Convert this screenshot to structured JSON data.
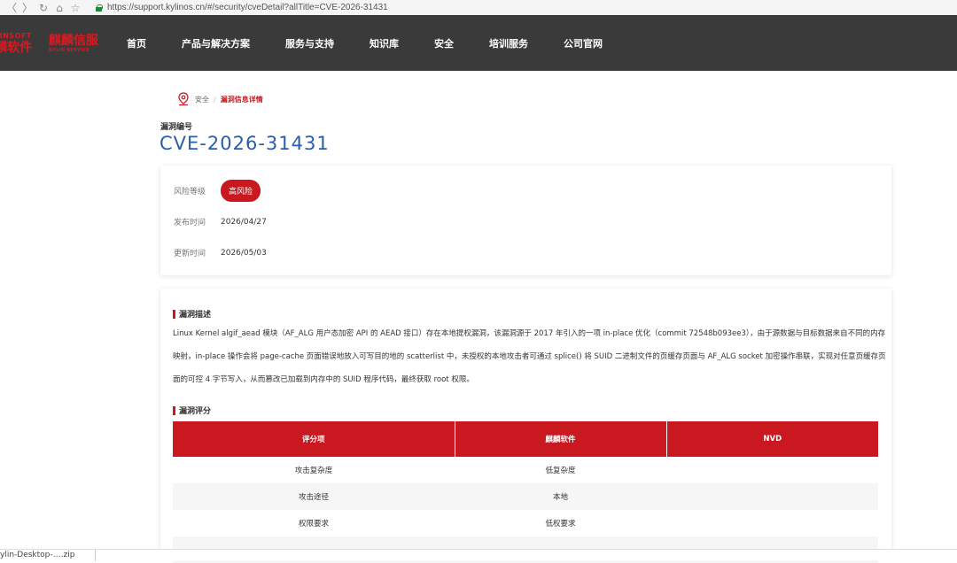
{
  "browser": {
    "back": "〈",
    "forward": "〉",
    "reload": "↻",
    "home": "⌂",
    "star": "☆",
    "url": "https://support.kylinos.cn/#/security/cveDetail?allTitle=CVE-2026-31431"
  },
  "header": {
    "logo_a_line1": "LINSOFT",
    "logo_a_line2": "麟软件",
    "logo_b_line1": "麒麟信服",
    "logo_b_line2": "KYLIN SERVICE",
    "nav": [
      "首页",
      "产品与解决方案",
      "服务与支持",
      "知识库",
      "安全",
      "培训服务",
      "公司官网"
    ]
  },
  "breadcrumb": {
    "home": "安全",
    "sep": "/",
    "current": "漏洞信息详情"
  },
  "cve": {
    "label": "漏洞编号",
    "id": "CVE-2026-31431"
  },
  "info": {
    "risk_label": "风险等级",
    "risk_value": "高风险",
    "published_label": "发布时间",
    "published_value": "2026/04/27",
    "updated_label": "更新时间",
    "updated_value": "2026/05/03"
  },
  "description": {
    "title": "漏洞描述",
    "lines": [
      "Linux Kernel algif_aead 模块（AF_ALG 用户态加密 API 的 AEAD 接口）存在本地提权漏洞，该漏洞源于 2017 年引入的一项 in-place 优化（commit 72548b093ee3），由于源数据与目标数据来自不同的内存",
      "映射，in-place 操作会将 page-cache 页面错误地放入可写目的地的 scatterlist 中，未授权的本地攻击者可通过 splice() 将 SUID 二进制文件的页缓存页面与 AF_ALG socket 加密操作串联，实现对任意页缓存页",
      "面的可控 4 字节写入，从而篡改已加载到内存中的 SUID 程序代码，最终获取 root 权限。"
    ]
  },
  "score": {
    "title": "漏洞评分",
    "headers": [
      "评分项",
      "麒麟软件",
      "NVD"
    ],
    "rows": [
      [
        "攻击复杂度",
        "低复杂度",
        ""
      ],
      [
        "攻击途径",
        "本地",
        ""
      ],
      [
        "权限要求",
        "低权要求",
        ""
      ],
      [
        "",
        "",
        ""
      ]
    ]
  },
  "download": {
    "file": "ylin-Desktop-….zip"
  }
}
